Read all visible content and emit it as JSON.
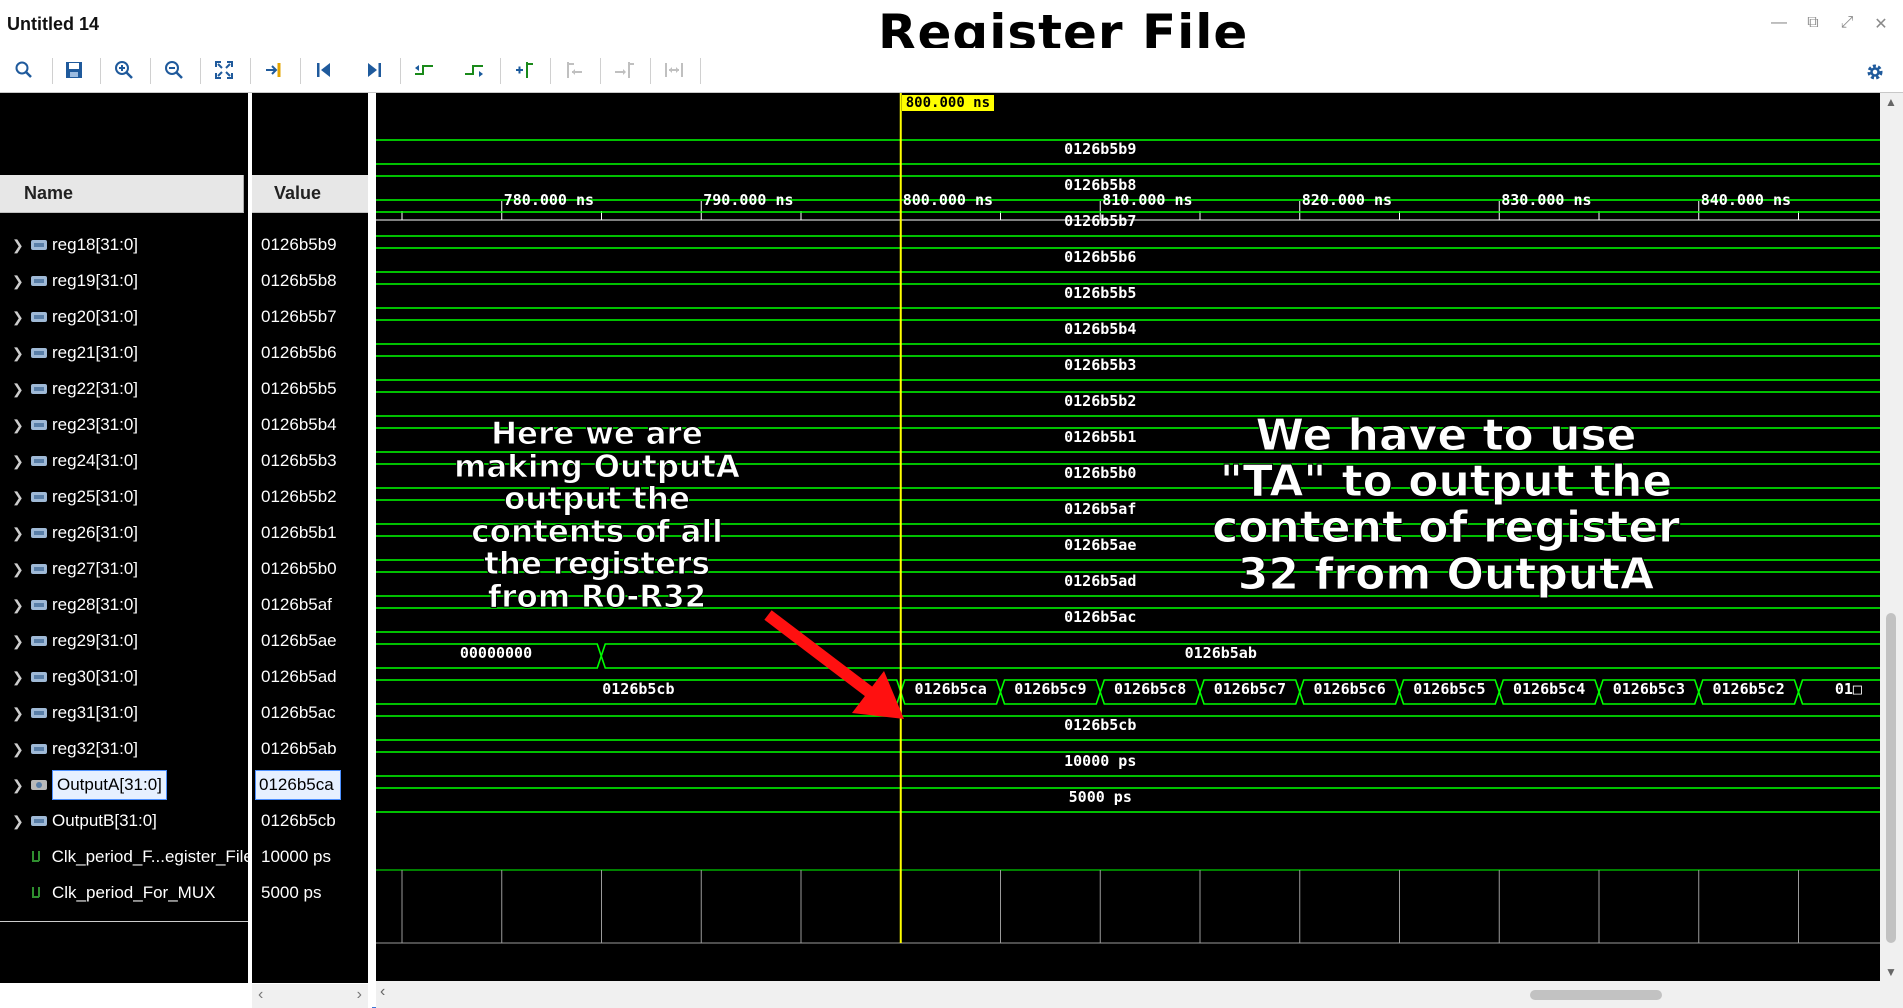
{
  "window": {
    "title": "Untitled 14",
    "overlay_title": "Register File"
  },
  "toolbar": {
    "buttons": [
      "search-icon",
      "save-icon",
      "zoom-in-icon",
      "zoom-out-icon",
      "zoom-fit-icon",
      "go-to-cursor-icon",
      "go-to-start-icon",
      "go-to-end-icon",
      "previous-transition-icon",
      "next-transition-icon",
      "add-marker-icon",
      "previous-marker-icon",
      "next-marker-icon",
      "swap-cursors-icon",
      "settings-icon"
    ]
  },
  "columns": {
    "name_header": "Name",
    "value_header": "Value"
  },
  "signals": [
    {
      "name": "reg18[31:0]",
      "value": "0126b5b9",
      "type": "bus",
      "wave": "0126b5b9"
    },
    {
      "name": "reg19[31:0]",
      "value": "0126b5b8",
      "type": "bus",
      "wave": "0126b5b8"
    },
    {
      "name": "reg20[31:0]",
      "value": "0126b5b7",
      "type": "bus",
      "wave": "0126b5b7"
    },
    {
      "name": "reg21[31:0]",
      "value": "0126b5b6",
      "type": "bus",
      "wave": "0126b5b6"
    },
    {
      "name": "reg22[31:0]",
      "value": "0126b5b5",
      "type": "bus",
      "wave": "0126b5b5"
    },
    {
      "name": "reg23[31:0]",
      "value": "0126b5b4",
      "type": "bus",
      "wave": "0126b5b4"
    },
    {
      "name": "reg24[31:0]",
      "value": "0126b5b3",
      "type": "bus",
      "wave": "0126b5b3"
    },
    {
      "name": "reg25[31:0]",
      "value": "0126b5b2",
      "type": "bus",
      "wave": "0126b5b2"
    },
    {
      "name": "reg26[31:0]",
      "value": "0126b5b1",
      "type": "bus",
      "wave": "0126b5b1"
    },
    {
      "name": "reg27[31:0]",
      "value": "0126b5b0",
      "type": "bus",
      "wave": "0126b5b0"
    },
    {
      "name": "reg28[31:0]",
      "value": "0126b5af",
      "type": "bus",
      "wave": "0126b5af"
    },
    {
      "name": "reg29[31:0]",
      "value": "0126b5ae",
      "type": "bus",
      "wave": "0126b5ae"
    },
    {
      "name": "reg30[31:0]",
      "value": "0126b5ad",
      "type": "bus",
      "wave": "0126b5ad"
    },
    {
      "name": "reg31[31:0]",
      "value": "0126b5ac",
      "type": "bus",
      "wave": "0126b5ac"
    },
    {
      "name": "reg32[31:0]",
      "value": "0126b5ab",
      "type": "bus",
      "wave": "0126b5ab",
      "early_value": "00000000"
    },
    {
      "name": "OutputA[31:0]",
      "value": "0126b5ca",
      "type": "bus-output",
      "selected": true,
      "wave": "0126b5cb",
      "segments": [
        "0126b5ca",
        "0126b5c9",
        "0126b5c8",
        "0126b5c7",
        "0126b5c6",
        "0126b5c5",
        "0126b5c4",
        "0126b5c3",
        "0126b5c2",
        "01□"
      ]
    },
    {
      "name": "OutputB[31:0]",
      "value": "0126b5cb",
      "type": "bus",
      "wave": "0126b5cb"
    },
    {
      "name": "Clk_period_F...egister_File",
      "value": "10000 ps",
      "type": "param",
      "wave": "10000 ps"
    },
    {
      "name": "Clk_period_For_MUX",
      "value": "5000 ps",
      "type": "param",
      "wave": "5000 ps"
    }
  ],
  "timeline": {
    "cursor_label": "800.000 ns",
    "ticks": [
      "780.000 ns",
      "790.000 ns",
      "800.000 ns",
      "810.000 ns",
      "820.000 ns",
      "830.000 ns",
      "840.000 ns"
    ]
  },
  "annotations": {
    "left_note": "Here we are making OutputA output the contents of all the registers from R0-R32",
    "right_note": "We have to use \"TA\" to output the content of register 32 from OutputA"
  },
  "colors": {
    "wave": "#00ff00",
    "cursor": "#ffff00",
    "arrow": "#ff1010",
    "selection": "#4d90fe"
  }
}
